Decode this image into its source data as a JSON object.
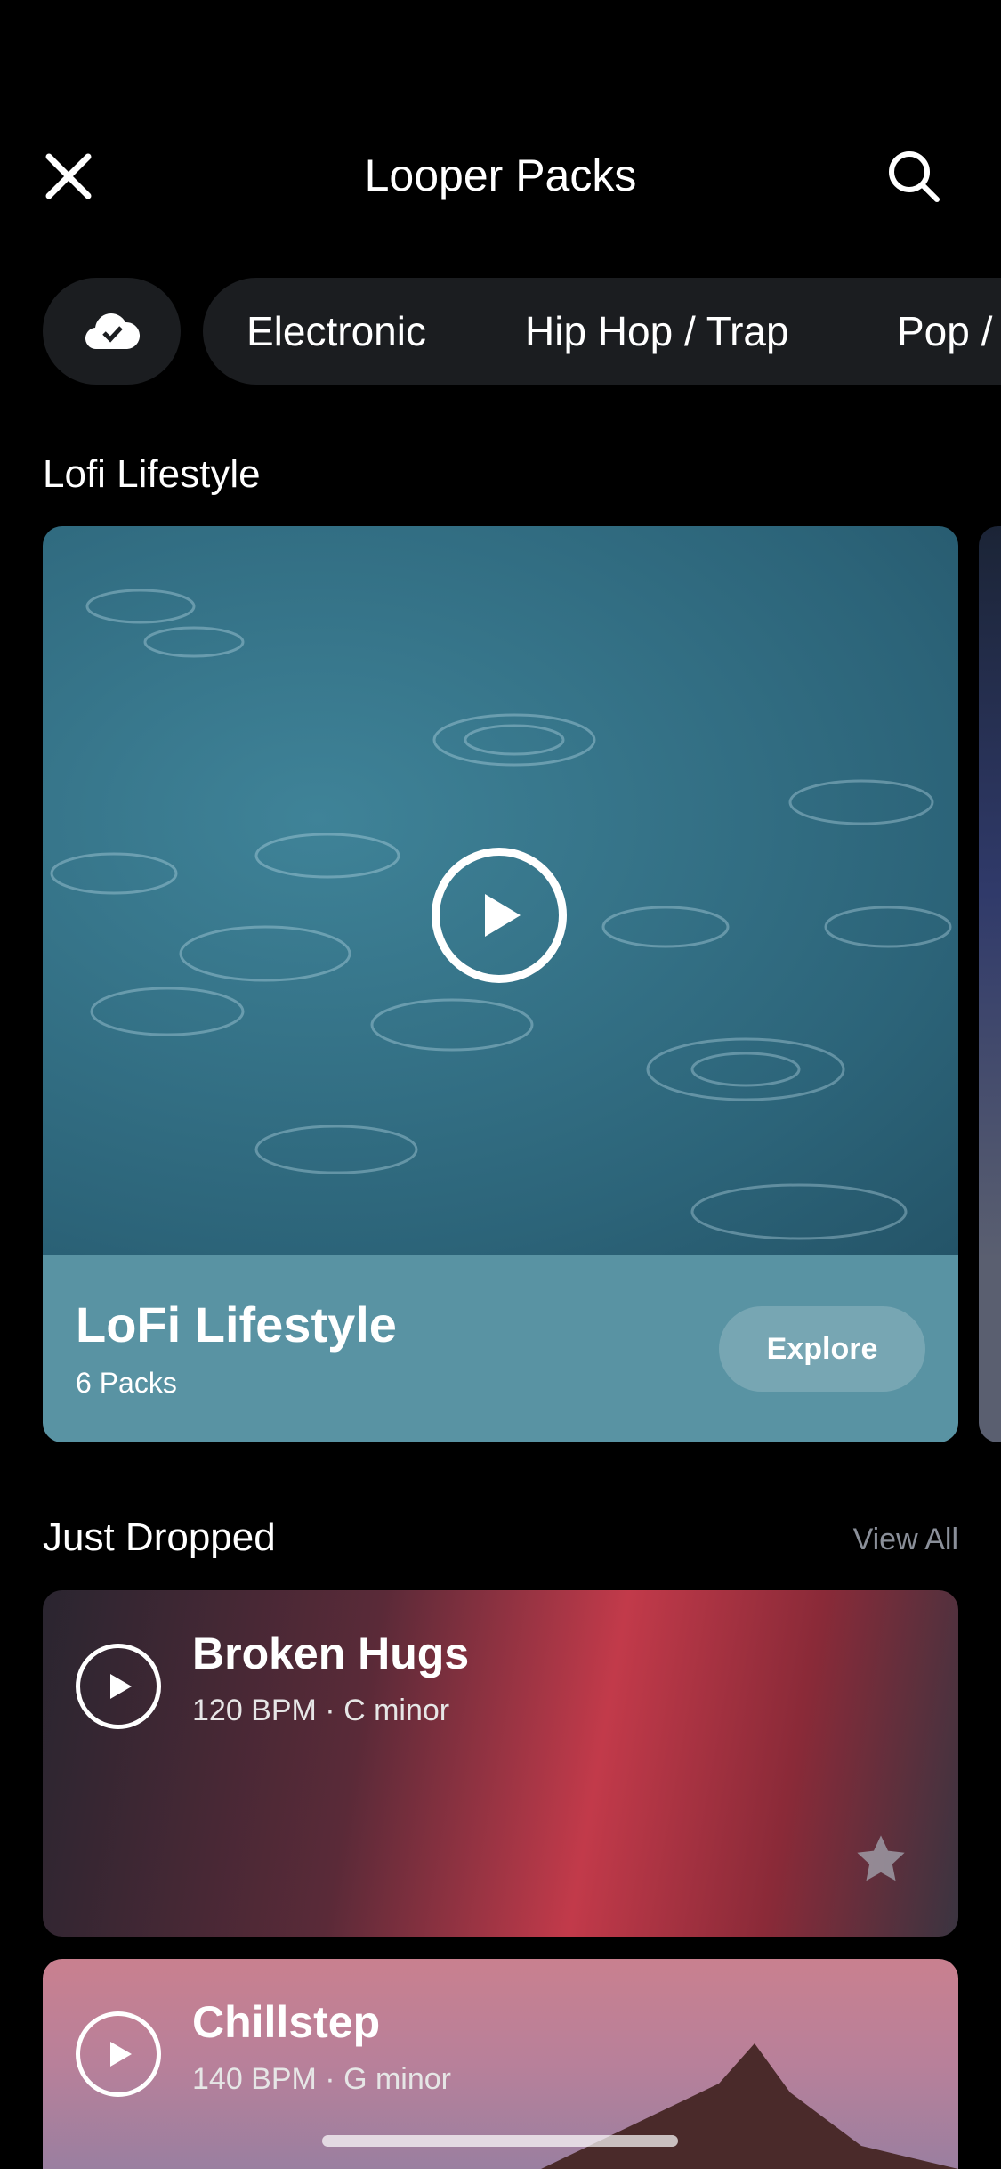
{
  "header": {
    "title": "Looper Packs",
    "close_icon": "close-icon",
    "search_icon": "search-icon"
  },
  "filters": {
    "downloaded_icon": "cloud-check-icon",
    "genres": [
      "Electronic",
      "Hip Hop / Trap",
      "Pop /"
    ]
  },
  "featured": {
    "section_title": "Lofi Lifestyle",
    "card": {
      "title": "LoFi Lifestyle",
      "subtitle": "6 Packs",
      "button": "Explore",
      "accent": "#5993a3"
    }
  },
  "just_dropped": {
    "section_title": "Just Dropped",
    "view_all": "View All",
    "items": [
      {
        "title": "Broken Hugs",
        "subtitle": "120 BPM · C minor",
        "favorite_icon": "star-icon"
      },
      {
        "title": "Chillstep",
        "subtitle": "140 BPM · G minor"
      }
    ]
  }
}
